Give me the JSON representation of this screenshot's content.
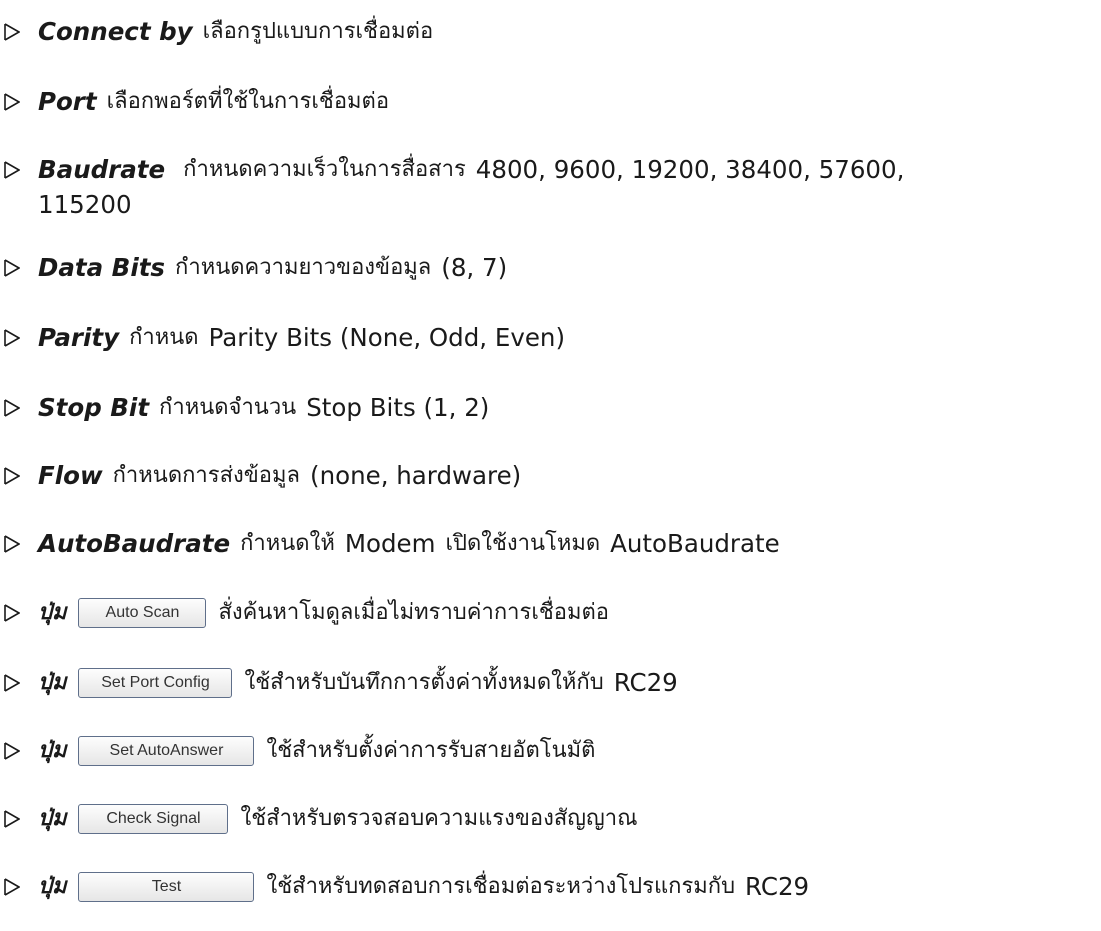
{
  "items": [
    {
      "term": "Connect by",
      "desc": "เลือกรูปแบบการเชื่อมต่อ"
    },
    {
      "term": "Port",
      "desc": "เลือกพอร์ตที่ใช้ในการเชื่อมต่อ"
    },
    {
      "term": "Baudrate",
      "desc": "กำหนดความเร็วในการสื่อสาร",
      "values": "4800, 9600, 19200, 38400, 57600,",
      "values_cont": "115200"
    },
    {
      "term": "Data Bits",
      "desc": "กำหนดความยาวของข้อมูล",
      "values": "(8, 7)"
    },
    {
      "term": "Parity",
      "desc": "กำหนด",
      "values": "Parity Bits (None, Odd, Even)"
    },
    {
      "term": "Stop Bit",
      "desc": "กำหนดจำนวน",
      "values": "Stop Bits (1, 2)"
    },
    {
      "term": "Flow",
      "desc": "กำหนดการส่งข้อมูล",
      "values": "(none, hardware)"
    },
    {
      "term": "AutoBaudrate",
      "desc": "กำหนดให้",
      "values": "Modem",
      "desc2": "เปิดใช้งานโหมด",
      "values2": "AutoBaudrate"
    }
  ],
  "buttons": [
    {
      "prefix": "ปุ่ม",
      "label": "Auto Scan",
      "desc": "สั่งค้นหาโมดูลเมื่อไม่ทราบค่าการเชื่อมต่อ"
    },
    {
      "prefix": "ปุ่ม",
      "label": "Set Port Config",
      "desc": "ใช้สำหรับบันทึกการตั้งค่าทั้งหมดให้กับ",
      "desc_en": "RC29"
    },
    {
      "prefix": "ปุ่ม",
      "label": "Set AutoAnswer",
      "desc": "ใช้สำหรับตั้งค่าการรับสายอัตโนมัติ"
    },
    {
      "prefix": "ปุ่ม",
      "label": "Check Signal",
      "desc": "ใช้สำหรับตรวจสอบความแรงของสัญญาณ"
    },
    {
      "prefix": "ปุ่ม",
      "label": "Test",
      "desc": "ใช้สำหรับทดสอบการเชื่อมต่อระหว่างโปรแกรมกับ",
      "desc_en": "RC29"
    }
  ]
}
